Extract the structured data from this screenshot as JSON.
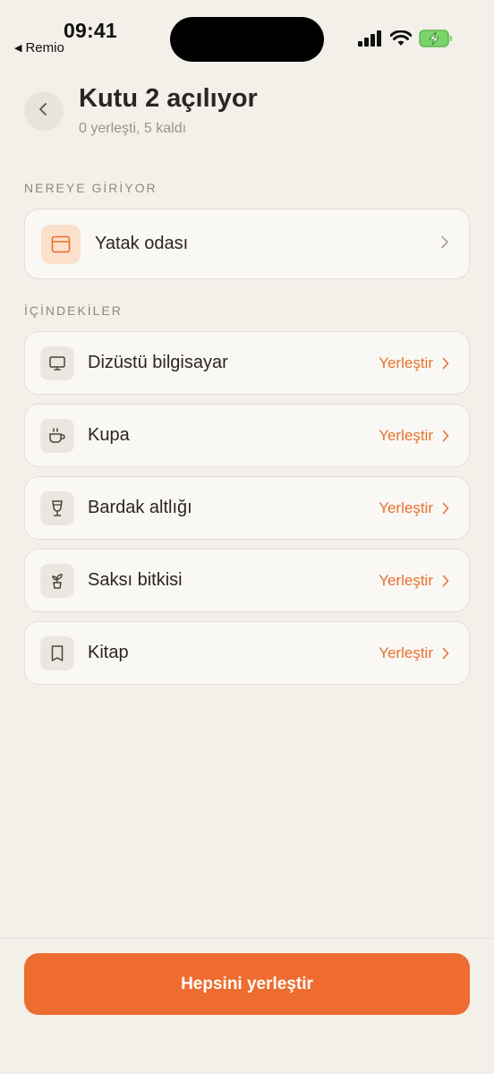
{
  "status_bar": {
    "time": "09:41",
    "back_app": "Remio",
    "icons": [
      "signal-icon",
      "wifi-icon",
      "battery-charging-icon"
    ]
  },
  "header": {
    "title": "Kutu 2 açılıyor",
    "subtitle": "0 yerleşti, 5 kaldı"
  },
  "destination": {
    "section_label": "NEREYE GİRİYOR",
    "room_name": "Yatak odası",
    "room_icon": "room-icon"
  },
  "contents": {
    "section_label": "İÇİNDEKİLER",
    "action_label": "Yerleştir",
    "items": [
      {
        "name": "Dizüstü bilgisayar",
        "icon": "laptop-icon"
      },
      {
        "name": "Kupa",
        "icon": "mug-icon"
      },
      {
        "name": "Bardak altlığı",
        "icon": "glass-icon"
      },
      {
        "name": "Saksı bitkisi",
        "icon": "plant-icon"
      },
      {
        "name": "Kitap",
        "icon": "book-icon"
      }
    ]
  },
  "footer": {
    "cta_label": "Hepsini yerleştir"
  },
  "colors": {
    "accent": "#ee6c2f",
    "background": "#f3f0ea",
    "card": "#faf8f4"
  }
}
